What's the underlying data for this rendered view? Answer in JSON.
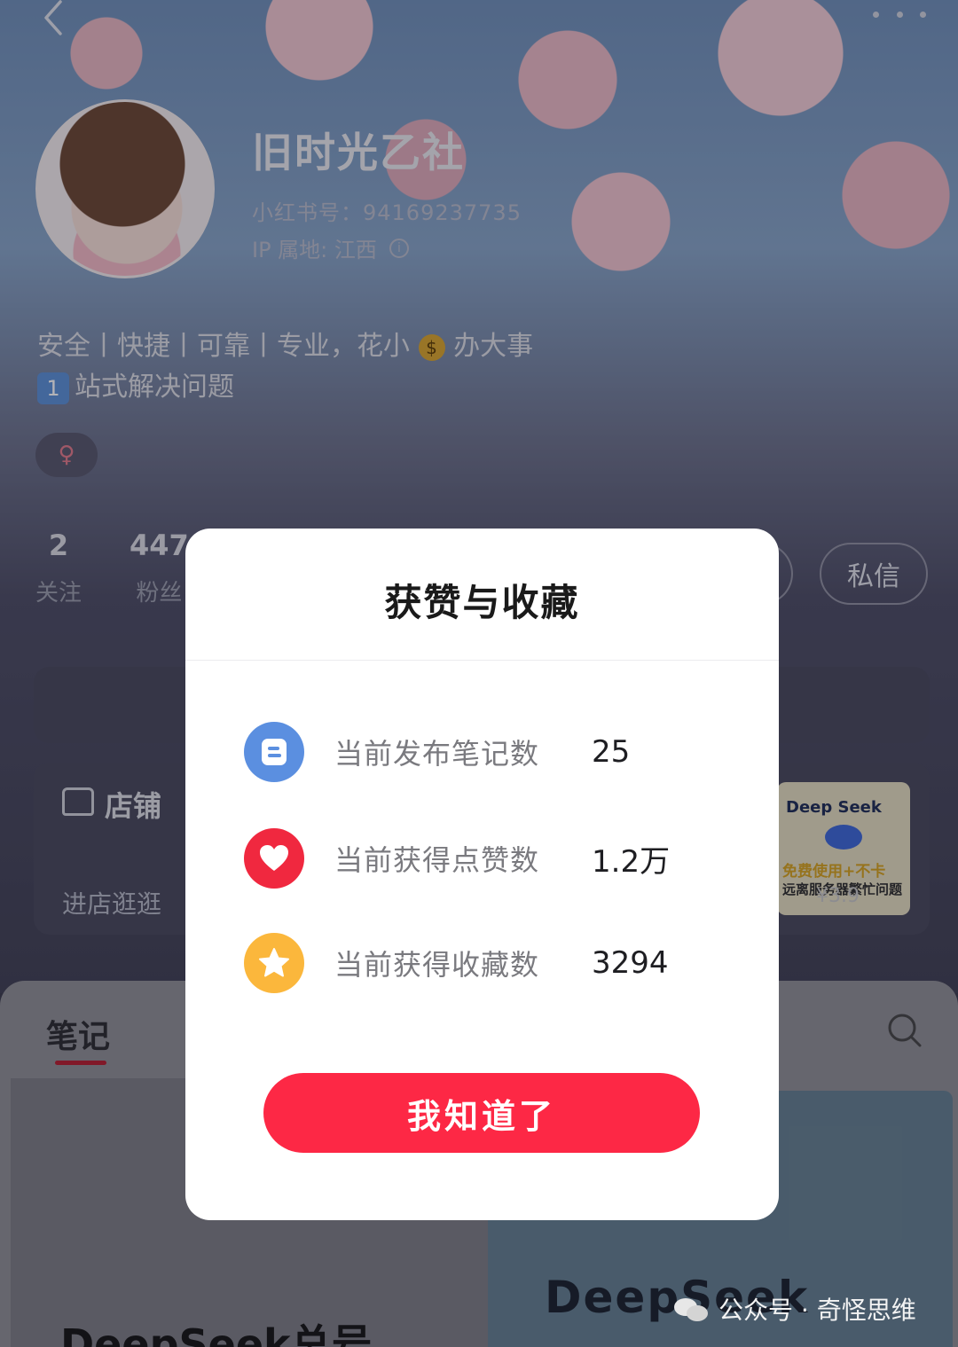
{
  "profile": {
    "name": "旧时光乙社",
    "id_text": "小红书号：94169237735",
    "ip_text": "IP 属地: 江西",
    "bio_line1_a": "安全丨快捷丨可靠丨专业，花小",
    "bio_line1_b": "办大事",
    "bio_line2_badge": "1",
    "bio_line2": "站式解决问题",
    "gender_symbol": "♀"
  },
  "stats": {
    "following_count": "2",
    "following_label": "关注",
    "followers_count": "447",
    "followers_label": "粉丝"
  },
  "actions": {
    "message_label": "私信"
  },
  "shop": {
    "title": "店铺",
    "link": "进店逛逛",
    "product_title": "Deep Seek",
    "product_line1": "免费使用+不卡",
    "product_line2": "远离服务器繁忙问题",
    "product_price": "¥3.9"
  },
  "tabs": {
    "notes": "笔记"
  },
  "notes": {
    "left_title": "DeepSeek总号",
    "right_title": "DeepSeek"
  },
  "watermark": {
    "text": "公众号 · 奇怪思维"
  },
  "modal": {
    "title": "获赞与收藏",
    "rows": [
      {
        "label": "当前发布笔记数",
        "value": "25",
        "icon": "note-icon",
        "color": "#5b8fe0"
      },
      {
        "label": "当前获得点赞数",
        "value": "1.2万",
        "icon": "heart-icon",
        "color": "#f0283f"
      },
      {
        "label": "当前获得收藏数",
        "value": "3294",
        "icon": "star-icon",
        "color": "#fbb73c"
      }
    ],
    "confirm_label": "我知道了"
  },
  "colors": {
    "accent": "#fd2845",
    "note_blue": "#5b8fe0",
    "heart_red": "#f0283f",
    "star_yellow": "#fbb73c"
  }
}
